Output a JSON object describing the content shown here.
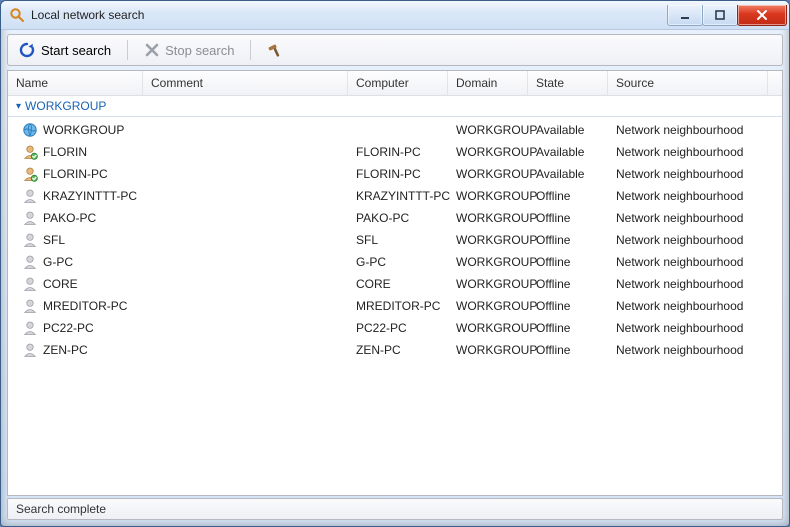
{
  "window": {
    "title": "Local network search"
  },
  "toolbar": {
    "start_label": "Start search",
    "stop_label": "Stop search"
  },
  "columns": [
    "Name",
    "Comment",
    "Computer",
    "Domain",
    "State",
    "Source"
  ],
  "group": {
    "label": "WORKGROUP"
  },
  "rows": [
    {
      "icon": "globe",
      "name": "WORKGROUP",
      "comment": "",
      "computer": "",
      "domain": "WORKGROUP",
      "state": "Available",
      "source": "Network neighbourhood"
    },
    {
      "icon": "user-on",
      "name": "FLORIN",
      "comment": "",
      "computer": "FLORIN-PC",
      "domain": "WORKGROUP",
      "state": "Available",
      "source": "Network neighbourhood"
    },
    {
      "icon": "user-on",
      "name": "FLORIN-PC",
      "comment": "",
      "computer": "FLORIN-PC",
      "domain": "WORKGROUP",
      "state": "Available",
      "source": "Network neighbourhood"
    },
    {
      "icon": "user-off",
      "name": "KRAZYINTTT-PC",
      "comment": "",
      "computer": "KRAZYINTTT-PC",
      "domain": "WORKGROUP",
      "state": "Offline",
      "source": "Network neighbourhood"
    },
    {
      "icon": "user-off",
      "name": "PAKO-PC",
      "comment": "",
      "computer": "PAKO-PC",
      "domain": "WORKGROUP",
      "state": "Offline",
      "source": "Network neighbourhood"
    },
    {
      "icon": "user-off",
      "name": "SFL",
      "comment": "",
      "computer": "SFL",
      "domain": "WORKGROUP",
      "state": "Offline",
      "source": "Network neighbourhood"
    },
    {
      "icon": "user-off",
      "name": "G-PC",
      "comment": "",
      "computer": "G-PC",
      "domain": "WORKGROUP",
      "state": "Offline",
      "source": "Network neighbourhood"
    },
    {
      "icon": "user-off",
      "name": "CORE",
      "comment": "",
      "computer": "CORE",
      "domain": "WORKGROUP",
      "state": "Offline",
      "source": "Network neighbourhood"
    },
    {
      "icon": "user-off",
      "name": "MREDITOR-PC",
      "comment": "",
      "computer": "MREDITOR-PC",
      "domain": "WORKGROUP",
      "state": "Offline",
      "source": "Network neighbourhood"
    },
    {
      "icon": "user-off",
      "name": "PC22-PC",
      "comment": "",
      "computer": "PC22-PC",
      "domain": "WORKGROUP",
      "state": "Offline",
      "source": "Network neighbourhood"
    },
    {
      "icon": "user-off",
      "name": "ZEN-PC",
      "comment": "",
      "computer": "ZEN-PC",
      "domain": "WORKGROUP",
      "state": "Offline",
      "source": "Network neighbourhood"
    }
  ],
  "status": {
    "text": "Search complete"
  }
}
